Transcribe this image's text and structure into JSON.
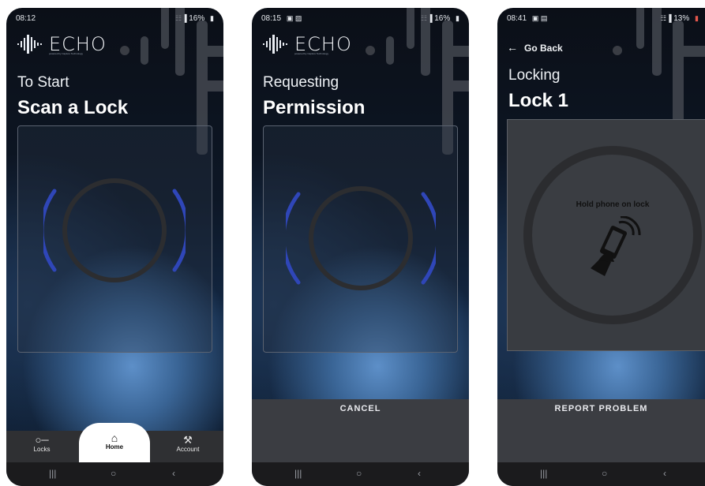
{
  "screens": [
    {
      "status": {
        "time": "08:12",
        "icons": "",
        "battery": "16%"
      },
      "logo": {
        "text": "ECHO",
        "tagline": "powered by Capture Technology"
      },
      "heading_small": "To Start",
      "heading_large": "Scan a Lock",
      "bottom_nav": [
        {
          "label": "Locks",
          "icon": "key-icon"
        },
        {
          "label": "Home",
          "icon": "home-icon",
          "active": true
        },
        {
          "label": "Account",
          "icon": "wrench-icon"
        }
      ]
    },
    {
      "status": {
        "time": "08:15",
        "icons": "▣ ▨",
        "battery": "16%"
      },
      "logo": {
        "text": "ECHO",
        "tagline": "powered by Capture Technology"
      },
      "heading_small": "Requesting",
      "heading_large": "Permission",
      "action_button": "CANCEL"
    },
    {
      "status": {
        "time": "08:41",
        "icons": "▣ ▤",
        "battery": "13%"
      },
      "go_back": "Go Back",
      "heading_small": "Locking",
      "heading_large": "Lock 1",
      "hold_text": "Hold phone on lock",
      "action_button": "REPORT PROBLEM"
    }
  ],
  "system_nav": {
    "recent": "|||",
    "home": "○",
    "back": "‹"
  },
  "colors": {
    "arc_blue": "#2f46b8",
    "ring": "#2b2c2f",
    "background_dark": "#0b0f17",
    "accent_light": "#5d8fc8"
  }
}
